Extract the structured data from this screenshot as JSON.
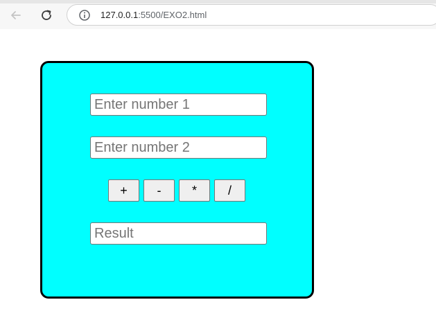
{
  "browser": {
    "url_host": "127.0.0.1",
    "url_rest": ":5500/EXO2.html"
  },
  "calculator": {
    "background_color": "#00ffff",
    "number1_placeholder": "Enter number 1",
    "number2_placeholder": "Enter number 2",
    "result_placeholder": "Result",
    "buttons": {
      "add": "+",
      "subtract": "-",
      "multiply": "*",
      "divide": "/"
    }
  }
}
